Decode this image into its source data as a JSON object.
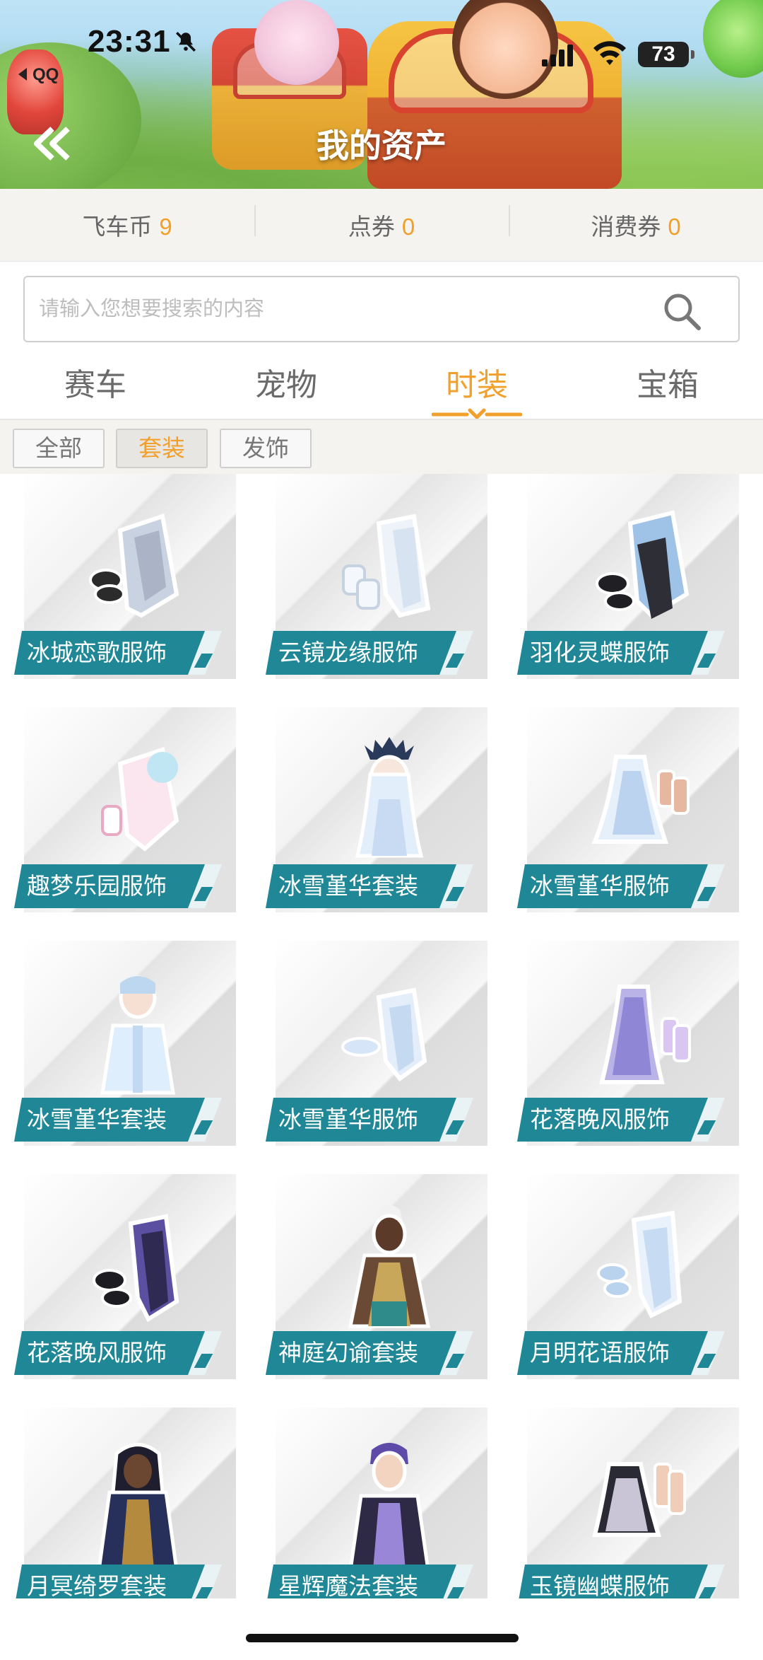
{
  "status_bar": {
    "time": "23:31",
    "back_app": "QQ",
    "battery": "73"
  },
  "header": {
    "title": "我的资产"
  },
  "currencies": [
    {
      "label": "飞车币",
      "value": "9"
    },
    {
      "label": "点券",
      "value": "0"
    },
    {
      "label": "消费券",
      "value": "0"
    }
  ],
  "search": {
    "placeholder": "请输入您想要搜索的内容"
  },
  "tabs": [
    {
      "label": "赛车"
    },
    {
      "label": "宠物"
    },
    {
      "label": "时装"
    },
    {
      "label": "宝箱"
    }
  ],
  "active_tab": "时装",
  "filters": [
    {
      "label": "全部"
    },
    {
      "label": "套装"
    },
    {
      "label": "发饰"
    }
  ],
  "active_filter": "套装",
  "items": [
    {
      "name": "冰城恋歌服饰"
    },
    {
      "name": "云镜龙缘服饰"
    },
    {
      "name": "羽化灵蝶服饰"
    },
    {
      "name": "趣梦乐园服饰"
    },
    {
      "name": "冰雪堇华套装"
    },
    {
      "name": "冰雪堇华服饰"
    },
    {
      "name": "冰雪堇华套装"
    },
    {
      "name": "冰雪堇华服饰"
    },
    {
      "name": "花落晚风服饰"
    },
    {
      "name": "花落晚风服饰"
    },
    {
      "name": "神庭幻谕套装"
    },
    {
      "name": "月明花语服饰"
    },
    {
      "name": "月冥绮罗套装"
    },
    {
      "name": "星辉魔法套装"
    },
    {
      "name": "玉镜幽蝶服饰"
    }
  ],
  "colors": {
    "accent": "#f2a02c",
    "label_bg": "#1f8795",
    "muted_text": "#6a6a6a"
  }
}
